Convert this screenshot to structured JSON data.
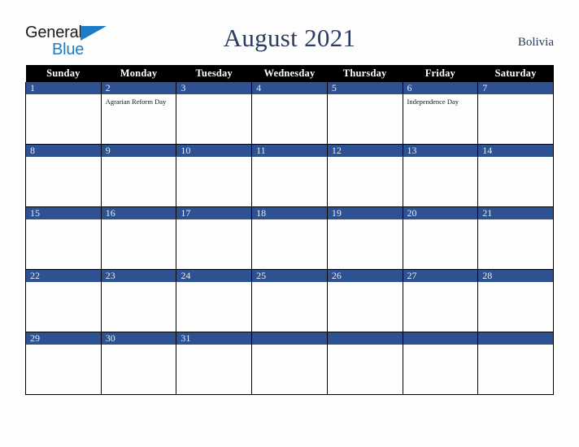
{
  "brand": {
    "name_part1": "General",
    "name_part2": "Blue",
    "color_dark": "#1b1b1b",
    "color_blue": "#1d7cc4"
  },
  "header": {
    "title": "August 2021",
    "country": "Bolivia",
    "title_color": "#2a3c63"
  },
  "calendar": {
    "month": "August",
    "year": "2021",
    "accent_color": "#2d5191",
    "header_bg": "#000000",
    "weekday_headers": [
      "Sunday",
      "Monday",
      "Tuesday",
      "Wednesday",
      "Thursday",
      "Friday",
      "Saturday"
    ],
    "weeks": [
      [
        {
          "day": "1",
          "events": []
        },
        {
          "day": "2",
          "events": [
            "Agrarian Reform Day"
          ]
        },
        {
          "day": "3",
          "events": []
        },
        {
          "day": "4",
          "events": []
        },
        {
          "day": "5",
          "events": []
        },
        {
          "day": "6",
          "events": [
            "Independence Day"
          ]
        },
        {
          "day": "7",
          "events": []
        }
      ],
      [
        {
          "day": "8",
          "events": []
        },
        {
          "day": "9",
          "events": []
        },
        {
          "day": "10",
          "events": []
        },
        {
          "day": "11",
          "events": []
        },
        {
          "day": "12",
          "events": []
        },
        {
          "day": "13",
          "events": []
        },
        {
          "day": "14",
          "events": []
        }
      ],
      [
        {
          "day": "15",
          "events": []
        },
        {
          "day": "16",
          "events": []
        },
        {
          "day": "17",
          "events": []
        },
        {
          "day": "18",
          "events": []
        },
        {
          "day": "19",
          "events": []
        },
        {
          "day": "20",
          "events": []
        },
        {
          "day": "21",
          "events": []
        }
      ],
      [
        {
          "day": "22",
          "events": []
        },
        {
          "day": "23",
          "events": []
        },
        {
          "day": "24",
          "events": []
        },
        {
          "day": "25",
          "events": []
        },
        {
          "day": "26",
          "events": []
        },
        {
          "day": "27",
          "events": []
        },
        {
          "day": "28",
          "events": []
        }
      ],
      [
        {
          "day": "29",
          "events": []
        },
        {
          "day": "30",
          "events": []
        },
        {
          "day": "31",
          "events": []
        },
        {
          "day": "",
          "events": []
        },
        {
          "day": "",
          "events": []
        },
        {
          "day": "",
          "events": []
        },
        {
          "day": "",
          "events": []
        }
      ]
    ]
  }
}
